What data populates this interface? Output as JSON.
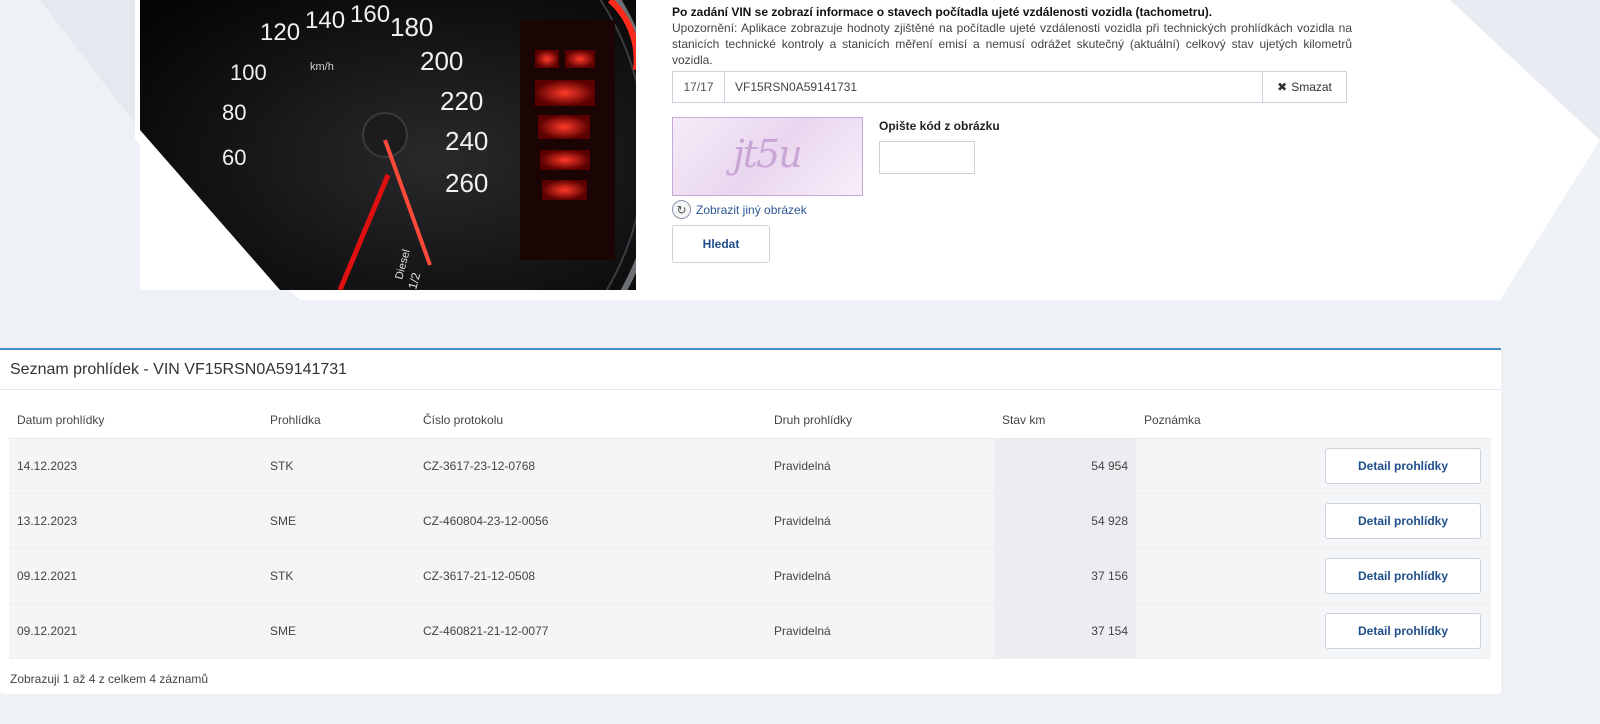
{
  "search": {
    "intro_bold": "Po zadání VIN se zobrazí informace o stavech počítadla ujeté vzdálenosti vozidla (tachometru).",
    "intro_text": "Upozornění: Aplikace zobrazuje hodnoty zjištěné na počítadle ujeté vzdálenosti vozidla při technických prohlídkách vozidla na stanicích technické kontroly a stanicích měření emisí a nemusí odrážet skutečný (aktuální) celkový stav ujetých kilometrů vozidla.",
    "char_count": "17/17",
    "vin_value": "VF15RSN0A59141731",
    "clear_icon": "✖",
    "clear_label": "Smazat",
    "captcha_code": "jt5u",
    "captcha_label": "Opište kód z obrázku",
    "reload_icon": "↻",
    "reload_label": "Zobrazit jiný obrázek",
    "submit_label": "Hledat"
  },
  "speedometer": {
    "labels": [
      "120",
      "140",
      "160",
      "180",
      "200",
      "220",
      "240",
      "260"
    ],
    "low_labels": [
      "100",
      "80",
      "60"
    ],
    "unit": "km/h",
    "fuel": "Diesel",
    "fuel_level": "1/2",
    "accent": "#e01010"
  },
  "results": {
    "title": "Seznam prohlídek - VIN VF15RSN0A59141731",
    "headers": {
      "date": "Datum prohlídky",
      "type": "Prohlídka",
      "protocol": "Číslo protokolu",
      "kind": "Druh prohlídky",
      "km": "Stav km",
      "note": "Poznámka"
    },
    "rows": [
      {
        "date": "14.12.2023",
        "type": "STK",
        "protocol": "CZ-3617-23-12-0768",
        "kind": "Pravidelná",
        "km": "54 954",
        "note": "",
        "button": "Detail prohlídky"
      },
      {
        "date": "13.12.2023",
        "type": "SME",
        "protocol": "CZ-460804-23-12-0056",
        "kind": "Pravidelná",
        "km": "54 928",
        "note": "",
        "button": "Detail prohlídky"
      },
      {
        "date": "09.12.2021",
        "type": "STK",
        "protocol": "CZ-3617-21-12-0508",
        "kind": "Pravidelná",
        "km": "37 156",
        "note": "",
        "button": "Detail prohlídky"
      },
      {
        "date": "09.12.2021",
        "type": "SME",
        "protocol": "CZ-460821-21-12-0077",
        "kind": "Pravidelná",
        "km": "37 154",
        "note": "",
        "button": "Detail prohlídky"
      }
    ],
    "summary": "Zobrazuji 1 až 4 z celkem 4 záznamů"
  }
}
